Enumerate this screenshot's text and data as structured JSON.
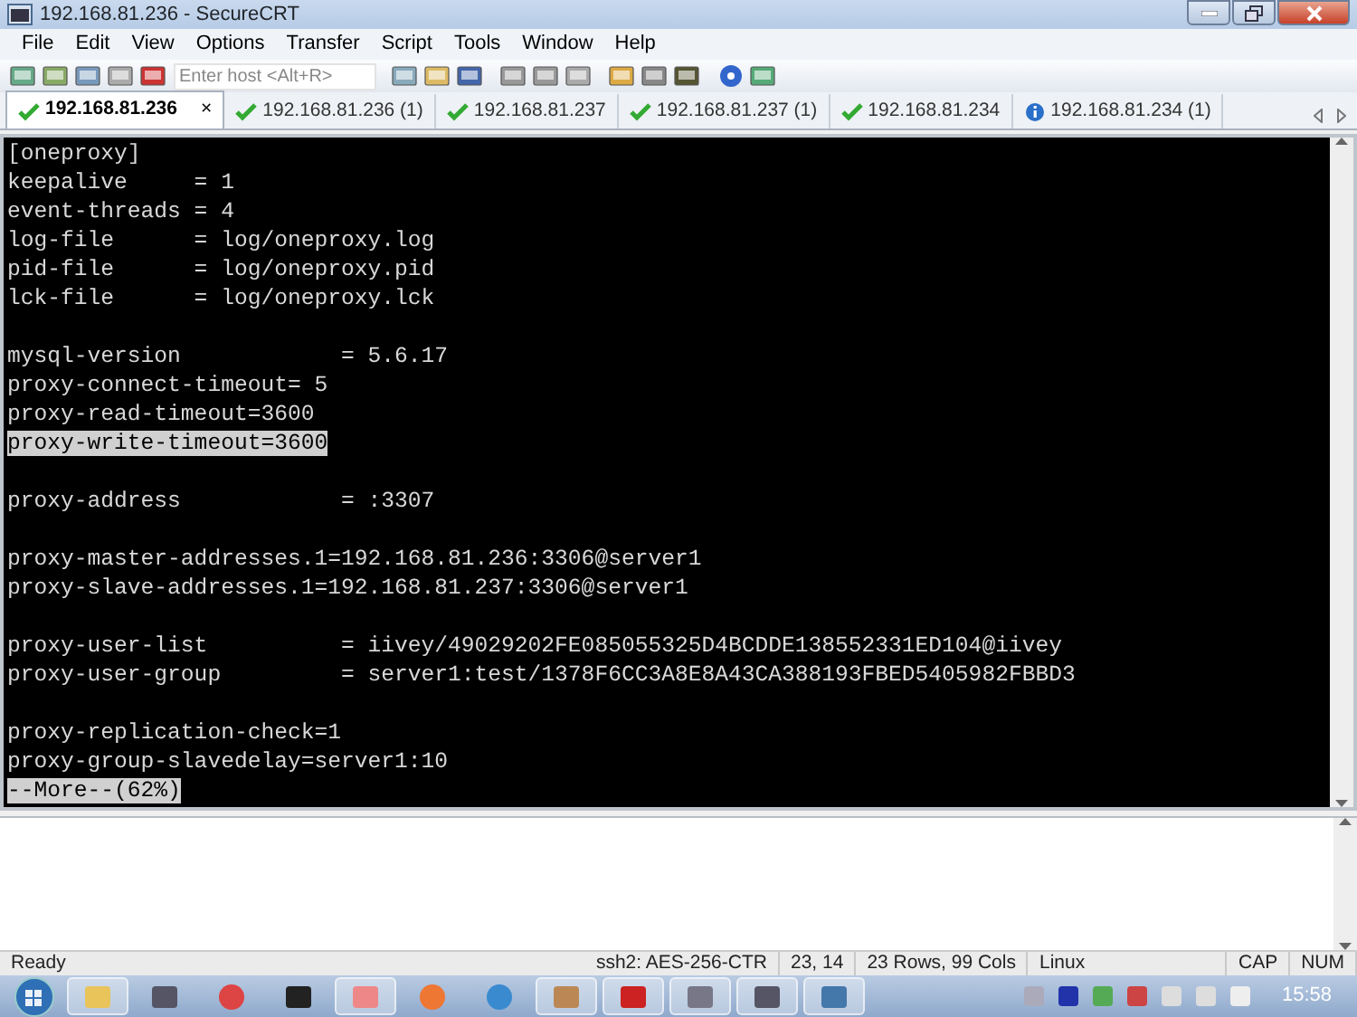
{
  "window": {
    "title": "192.168.81.236 - SecureCRT"
  },
  "menu": [
    "File",
    "Edit",
    "View",
    "Options",
    "Transfer",
    "Script",
    "Tools",
    "Window",
    "Help"
  ],
  "toolbar": {
    "host_field": {
      "placeholder": "Enter host <Alt+R>"
    }
  },
  "tabs": [
    {
      "label": "192.168.81.236",
      "selected": true,
      "kind": "connected"
    },
    {
      "label": "192.168.81.236 (1)",
      "selected": false,
      "kind": "connected"
    },
    {
      "label": "192.168.81.237",
      "selected": false,
      "kind": "connected"
    },
    {
      "label": "192.168.81.237 (1)",
      "selected": false,
      "kind": "connected"
    },
    {
      "label": "192.168.81.234",
      "selected": false,
      "kind": "connected"
    },
    {
      "label": "192.168.81.234 (1)",
      "selected": false,
      "kind": "info"
    }
  ],
  "tab_close": "×",
  "terminal": {
    "blocks": [
      [
        {
          "text": "[oneproxy]",
          "selected": false
        },
        {
          "text": "keepalive     = 1",
          "selected": false
        },
        {
          "text": "event-threads = 4",
          "selected": false
        },
        {
          "text": "log-file      = log/oneproxy.log",
          "selected": false
        },
        {
          "text": "pid-file      = log/oneproxy.pid",
          "selected": false
        },
        {
          "text": "lck-file      = log/oneproxy.lck",
          "selected": false
        }
      ],
      [
        {
          "text": "mysql-version            = 5.6.17",
          "selected": false
        },
        {
          "text": "proxy-connect-timeout= 5",
          "selected": false
        },
        {
          "text": "proxy-read-timeout=3600",
          "selected": false
        },
        {
          "text": "proxy-write-timeout=3600",
          "selected": true
        }
      ],
      [
        {
          "text": "proxy-address            = :3307",
          "selected": false
        }
      ],
      [
        {
          "text": "proxy-master-addresses.1=192.168.81.236:3306@server1",
          "selected": false
        },
        {
          "text": "proxy-slave-addresses.1=192.168.81.237:3306@server1",
          "selected": false
        }
      ],
      [
        {
          "text": "proxy-user-list          = iivey/49029202FE085055325D4BCDDE138552331ED104@iivey",
          "selected": false
        },
        {
          "text": "proxy-user-group         = server1:test/1378F6CC3A8E8A43CA388193FBED5405982FBBD3",
          "selected": false
        }
      ],
      [
        {
          "text": "proxy-replication-check=1",
          "selected": false
        },
        {
          "text": "proxy-group-slavedelay=server1:10",
          "selected": false
        }
      ]
    ],
    "pager_prompt": "--More--(62%)"
  },
  "status_bar": [
    "Ready",
    "ssh2: AES-256-CTR",
    "23,  14",
    "23 Rows, 99 Cols",
    "Linux",
    "CAP",
    "NUM"
  ],
  "taskbar": {
    "clock": "15:58"
  }
}
